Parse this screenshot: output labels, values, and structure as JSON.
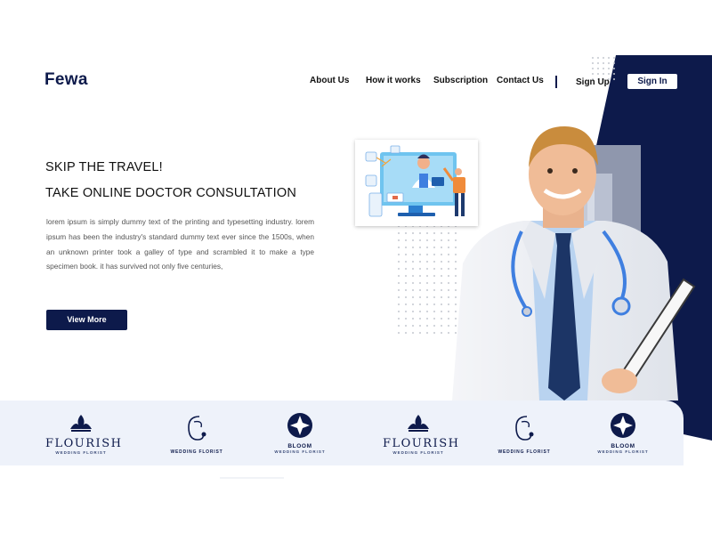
{
  "brand": {
    "name": "Fewa"
  },
  "nav": {
    "links": [
      "About Us",
      "How it works",
      "Subscription",
      "Contact Us"
    ],
    "signup_label": "Sign Up",
    "signin_label": "Sign In"
  },
  "hero": {
    "title_line1": "SKIP THE TRAVEL!",
    "title_line2": "TAKE ONLINE DOCTOR CONSULTATION",
    "description": "lorem ipsum is simply dummy text of the printing and typesetting industry. lorem ipsum has been the industry's standard dummy text ever since the 1500s, when an unknown printer took a galley of type and scrambled it to make a type specimen book. it has survived not only five centuries,",
    "cta_label": "View More"
  },
  "partners": [
    {
      "name": "FLOURISH",
      "sub": "WEDDING FLORIST",
      "style": "flourish"
    },
    {
      "name": "WEDDING FLORIST",
      "sub": "",
      "style": "script"
    },
    {
      "name": "BLOOM",
      "sub": "WEDDING FLORIST",
      "style": "bloom"
    },
    {
      "name": "FLOURISH",
      "sub": "WEDDING FLORIST",
      "style": "flourish"
    },
    {
      "name": "WEDDING FLORIST",
      "sub": "",
      "style": "script"
    },
    {
      "name": "BLOOM",
      "sub": "WEDDING FLORIST",
      "style": "bloom"
    }
  ],
  "colors": {
    "navy": "#0d1a4b",
    "strip": "#eef2fa",
    "accent_blue": "#3f7fe0"
  }
}
